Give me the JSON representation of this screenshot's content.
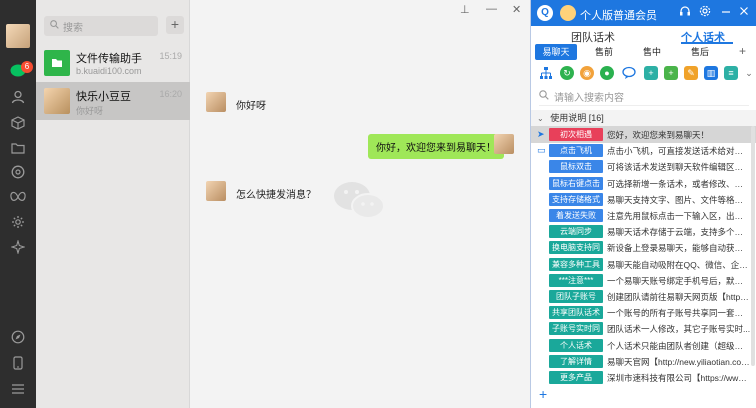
{
  "sidebar": {
    "unread_badge": "6",
    "icons": [
      "chat-icon",
      "contacts-icon",
      "box-icon",
      "folder-icon",
      "moments-icon",
      "butterfly-icon",
      "settings-gear-icon",
      "mini-program-icon",
      "compass-icon",
      "phone-icon",
      "menu-icon"
    ]
  },
  "chatlist": {
    "search_placeholder": "搜索",
    "plus": "+",
    "items": [
      {
        "name": "文件传输助手",
        "subtitle": "b.kuaidi100.com",
        "time": "15:19"
      },
      {
        "name": "快乐小豆豆",
        "subtitle": "你好呀",
        "time": "16:20"
      }
    ]
  },
  "chat": {
    "messages": [
      {
        "side": "left",
        "text": "你好呀"
      },
      {
        "side": "right",
        "text": "你好，欢迎您来到易聊天！"
      },
      {
        "side": "left",
        "text": "怎么快捷发消息？"
      }
    ],
    "pin": "⊥",
    "minimize": "—",
    "close": "✕"
  },
  "panel": {
    "title": "个人版普通会员",
    "tabs": [
      "团队话术",
      "个人话术"
    ],
    "active_tab": 1,
    "subtabs": [
      "易聊天教...",
      "售前",
      "售中",
      "售后"
    ],
    "subtab_plus": "+",
    "search_placeholder": "请输入搜索内容",
    "group": "使用说明 [16]",
    "rows": [
      {
        "tag": "初次相遇",
        "color": "#e8405a",
        "text": "您好，欢迎您来到易聊天！"
      },
      {
        "tag": "点击飞机",
        "color": "#3a86e8",
        "text": "点击小飞机，可直接发送话术给对方 <..."
      },
      {
        "tag": "鼠标双击",
        "color": "#3a86e8",
        "text": "可将该话术发送到聊天软件编辑区【例】..."
      },
      {
        "tag": "鼠标右键点击",
        "color": "#3a86e8",
        "text": "可选择新增一条话术，或者修改、删除..."
      },
      {
        "tag": "支持存储格式",
        "color": "#3a86e8",
        "text": "易聊天支持文字、图片、文件等格式。您..."
      },
      {
        "tag": "着发送失败",
        "color": "#3a86e8",
        "text": "注意先用鼠标点击一下输入区，出现光标..."
      },
      {
        "tag": "云端同步",
        "color": "#1aa89a",
        "text": "易聊天话术存储于云端，支持多个子账号..."
      },
      {
        "tag": "换电脑支持同步",
        "color": "#1aa89a",
        "text": "新设备上登录易聊天，能够自动获取已..."
      },
      {
        "tag": "兼容多种工具",
        "color": "#1aa89a",
        "text": "易聊天能自动吸附在QQ、微信、企业微..."
      },
      {
        "tag": "***注意***",
        "color": "#1aa89a",
        "text": "一个易聊天账号绑定手机号后，默认有三..."
      },
      {
        "tag": "团队子账号",
        "color": "#1aa89a",
        "text": "创建团队请前往易聊天网页版【http://ww..."
      },
      {
        "tag": "共享团队话术",
        "color": "#1aa89a",
        "text": "一个账号的所有子账号共享同一套团队话..."
      },
      {
        "tag": "子账号实时同步",
        "color": "#1aa89a",
        "text": "团队话术一人修改，其它子账号实时..."
      },
      {
        "tag": "个人话术",
        "color": "#1aa89a",
        "text": "个人话术只能由团队者创建（超级管理员..."
      },
      {
        "tag": "了解详情",
        "color": "#1aa89a",
        "text": "易聊天官网【http://new.yiliaotian.com/..."
      },
      {
        "tag": "更多产品",
        "color": "#1aa89a",
        "text": "深圳市速科技有限公司【https://www.foo..."
      }
    ],
    "bottom_plus": "+",
    "accent": "#1e77e0"
  }
}
